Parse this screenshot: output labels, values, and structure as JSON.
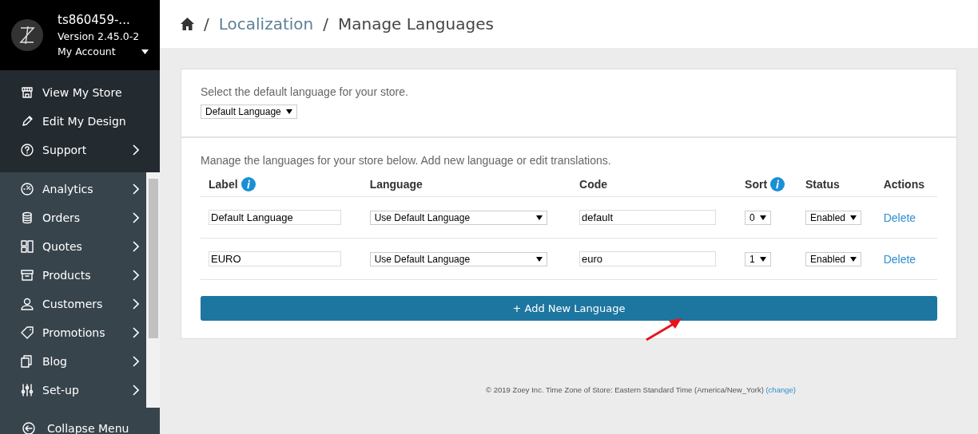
{
  "account": {
    "store": "ts860459-...",
    "version": "Version 2.45.0-2",
    "menu": "My Account"
  },
  "quick_links": [
    {
      "label": "View My Store",
      "has_submenu": false
    },
    {
      "label": "Edit My Design",
      "has_submenu": false
    },
    {
      "label": "Support",
      "has_submenu": true
    }
  ],
  "sidebar": {
    "items": [
      {
        "label": "Analytics"
      },
      {
        "label": "Orders"
      },
      {
        "label": "Quotes"
      },
      {
        "label": "Products"
      },
      {
        "label": "Customers"
      },
      {
        "label": "Promotions"
      },
      {
        "label": "Blog"
      },
      {
        "label": "Set-up"
      }
    ],
    "collapse": "Collapse Menu"
  },
  "breadcrumb": [
    {
      "kind": "separator",
      "text": "/"
    },
    {
      "kind": "link",
      "text": "Localization"
    },
    {
      "kind": "separator",
      "text": "/"
    },
    {
      "kind": "current",
      "text": "Manage Languages"
    }
  ],
  "default_section": {
    "text": "Select the default language for your store.",
    "select": "Default Language"
  },
  "languages_section": {
    "text": "Manage the languages for your store below. Add new language or edit translations.",
    "columns": [
      {
        "label": "Label",
        "info": true
      },
      {
        "label": "Language",
        "info": false
      },
      {
        "label": "Code",
        "info": false
      },
      {
        "label": "Sort",
        "info": true
      },
      {
        "label": "Status",
        "info": false
      },
      {
        "label": "Actions",
        "info": false
      }
    ],
    "rows": [
      {
        "label": "Default Language",
        "language": "Use Default Language",
        "code": "default",
        "sort": "0",
        "status": "Enabled",
        "action": "Delete"
      },
      {
        "label": "EURO",
        "language": "Use Default Language",
        "code": "euro",
        "sort": "1",
        "status": "Enabled",
        "action": "Delete"
      }
    ],
    "add_button": "+ Add New Language"
  },
  "footer": {
    "text": "© 2019 Zoey Inc. Time Zone of Store: Eastern Standard Time (America/New_York)",
    "link": "(change)"
  }
}
